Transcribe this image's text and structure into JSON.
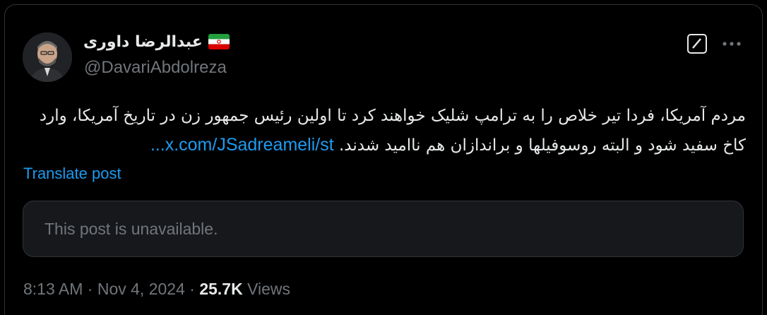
{
  "author": {
    "display_name": "عبدالرضا داوری",
    "handle": "@DavariAbdolreza",
    "flag_icon": "iran-flag-icon"
  },
  "actions": {
    "grok_icon": "grok-icon",
    "more_icon": "more-icon"
  },
  "tweet": {
    "text": "مردم آمریکا، فردا تیر خلاص را به ترامپ شلیک خواهند کرد تا اولین رئیس جمهور زن در تاریخ آمریکا، وارد کاخ سفید شود و البته روسوفیلها و براندازان هم ناامید شدند.",
    "link": "x.com/JSadreameli/st...",
    "translate_label": "Translate post"
  },
  "quoted": {
    "unavailable_text": "This post is unavailable."
  },
  "meta": {
    "time": "8:13 AM",
    "separator1": " · ",
    "date": "Nov 4, 2024",
    "separator2": " · ",
    "views_count": "25.7K",
    "views_label": " Views"
  },
  "colors": {
    "background": "#000000",
    "text": "#e7e9ea",
    "secondary": "#71767b",
    "link": "#1d9bf0",
    "card": "#16181c"
  }
}
